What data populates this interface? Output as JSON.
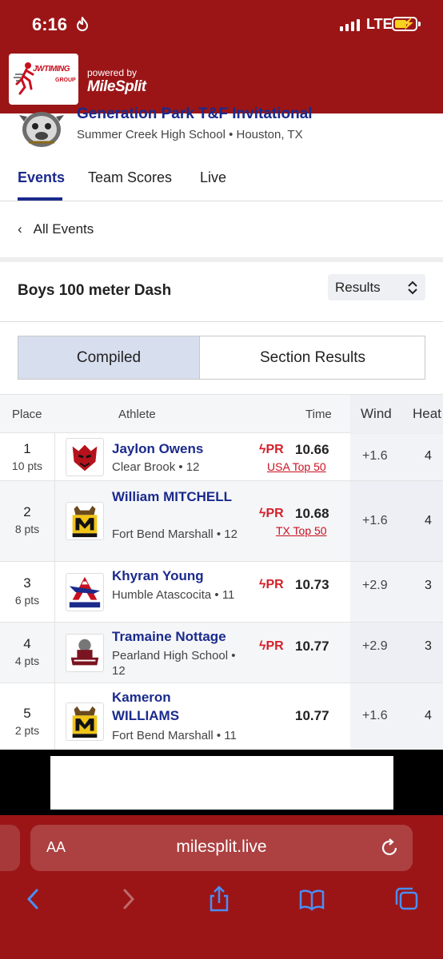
{
  "status": {
    "time": "6:16",
    "network": "LTE"
  },
  "header": {
    "logo_text": "JWTIMING",
    "logo_sub": "GROUP",
    "powered_by": "powered by",
    "brand": "MileSplit"
  },
  "meet": {
    "title": "Generation Park T&F Invitational",
    "location": "Summer Creek High School • Houston, TX"
  },
  "tabs": [
    {
      "label": "Events",
      "active": true
    },
    {
      "label": "Team Scores",
      "active": false
    },
    {
      "label": "Live",
      "active": false
    }
  ],
  "nav": {
    "back_label": "All Events"
  },
  "event": {
    "title": "Boys 100 meter Dash",
    "view_select": "Results"
  },
  "segments": {
    "compiled": "Compiled",
    "section": "Section Results"
  },
  "table": {
    "headers": {
      "place": "Place",
      "athlete": "Athlete",
      "time": "Time",
      "wind": "Wind",
      "heat": "Heat"
    },
    "rows": [
      {
        "place": "1",
        "pts": "10 pts",
        "name": "Jaylon Owens",
        "team": "Clear Brook • 12",
        "pr": "PR",
        "time": "10.66",
        "rank": "USA Top 50",
        "wind": "+1.6",
        "heat": "4"
      },
      {
        "place": "2",
        "pts": "8 pts",
        "name": "William MITCHELL",
        "team": "Fort Bend Marshall • 12",
        "pr": "PR",
        "time": "10.68",
        "rank": "TX Top 50",
        "wind": "+1.6",
        "heat": "4"
      },
      {
        "place": "3",
        "pts": "6 pts",
        "name": "Khyran Young",
        "team": "Humble Atascocita • 11",
        "pr": "PR",
        "time": "10.73",
        "rank": "",
        "wind": "+2.9",
        "heat": "3"
      },
      {
        "place": "4",
        "pts": "4 pts",
        "name": "Tramaine Nottage",
        "team": "Pearland High School • 12",
        "pr": "PR",
        "time": "10.77",
        "rank": "",
        "wind": "+2.9",
        "heat": "3"
      },
      {
        "place": "5",
        "pts": "2 pts",
        "name": "Kameron WILLIAMS",
        "team": "Fort Bend Marshall • 11",
        "pr": "",
        "time": "10.77",
        "rank": "",
        "wind": "+1.6",
        "heat": "4"
      }
    ]
  },
  "browser": {
    "aa": "AA",
    "url": "milesplit.live"
  },
  "colors": {
    "header_red": "#9b1517",
    "link_blue": "#1a2a8c",
    "pr_red": "#d4202a"
  },
  "icons": [
    "flame-icon",
    "signal-icon",
    "battery-icon",
    "chevron-left-icon",
    "select-chevron-icon",
    "reload-icon",
    "back-icon",
    "forward-icon",
    "share-icon",
    "bookmarks-icon",
    "tabs-icon"
  ]
}
